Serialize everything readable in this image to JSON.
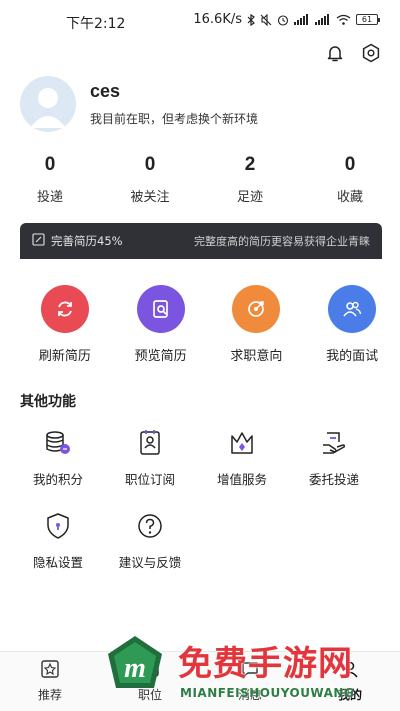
{
  "status_bar": {
    "time": "下午2:12",
    "network_speed": "16.6K/s",
    "battery": "61"
  },
  "header": {
    "icons": [
      "bell-icon",
      "settings-icon"
    ]
  },
  "profile": {
    "name": "ces",
    "status": "我目前在职，但考虑换个新环境"
  },
  "stats": [
    {
      "value": "0",
      "label": "投递"
    },
    {
      "value": "0",
      "label": "被关注"
    },
    {
      "value": "2",
      "label": "足迹"
    },
    {
      "value": "0",
      "label": "收藏"
    }
  ],
  "banner": {
    "left": "完善简历45%",
    "right": "完整度高的简历更容易获得企业青睐",
    "progress_percent": 45
  },
  "actions": [
    {
      "label": "刷新简历",
      "icon": "refresh-icon",
      "color": "#e94b55"
    },
    {
      "label": "预览简历",
      "icon": "preview-icon",
      "color": "#7b55e0"
    },
    {
      "label": "求职意向",
      "icon": "target-icon",
      "color": "#f08a3c"
    },
    {
      "label": "我的面试",
      "icon": "people-icon",
      "color": "#4a7de8"
    }
  ],
  "other_title": "其他功能",
  "functions": [
    {
      "label": "我的积分",
      "icon": "points-icon"
    },
    {
      "label": "职位订阅",
      "icon": "subscribe-icon"
    },
    {
      "label": "增值服务",
      "icon": "crown-icon"
    },
    {
      "label": "委托投递",
      "icon": "delegate-icon"
    },
    {
      "label": "隐私设置",
      "icon": "shield-icon"
    },
    {
      "label": "建议与反馈",
      "icon": "question-icon"
    }
  ],
  "bottom_nav": [
    {
      "label": "推荐",
      "icon": "recommend-icon"
    },
    {
      "label": "职位",
      "icon": "job-icon"
    },
    {
      "label": "消息",
      "icon": "message-icon"
    },
    {
      "label": "我的",
      "icon": "me-icon",
      "active": true
    }
  ],
  "watermark": {
    "title": "免费手游网",
    "subtitle": "MIANFEISHOUYOUWANG",
    "logo_letter": "m"
  }
}
